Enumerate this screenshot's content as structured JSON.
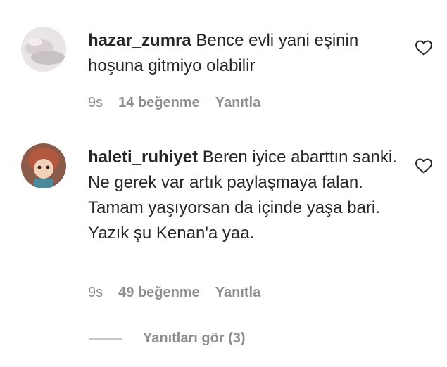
{
  "comments": [
    {
      "username": "hazar_zumra",
      "text": "Bence evli yani eşinin hoşuna gitmiyo olabilir",
      "time": "9s",
      "likes": "14 beğenme",
      "reply": "Yanıtla",
      "avatar_icon": "profile-photo"
    },
    {
      "username": "haleti_ruhiyet",
      "text": "Beren iyice abarttın sanki. Ne gerek var artık paylaşmaya falan. Tamam yaşıyorsan da içinde yaşa bari. Yazık şu Kenan'a yaa.",
      "time": "9s",
      "likes": "49 beğenme",
      "reply": "Yanıtla",
      "avatar_icon": "profile-photo"
    }
  ],
  "view_replies": "Yanıtları gör (3)",
  "icons": {
    "like": "heart-outline-icon"
  },
  "colors": {
    "text": "#262626",
    "secondary": "#8e8e8e"
  }
}
